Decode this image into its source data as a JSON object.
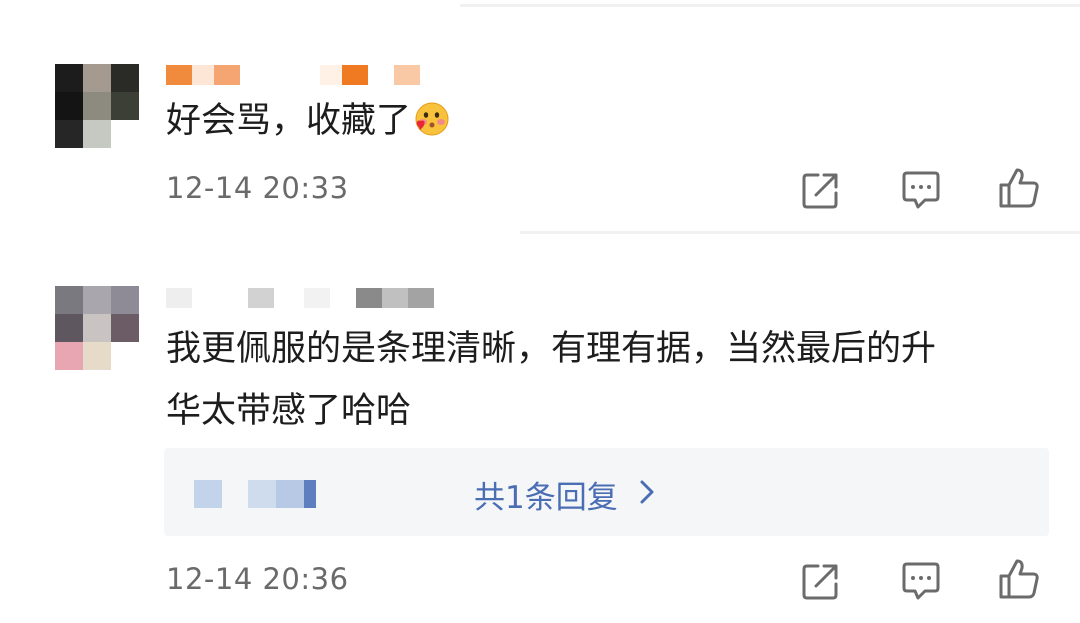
{
  "colors": {
    "link": "#4a6db3",
    "time": "#6a6a6a",
    "text": "#1d1d1d",
    "icon": "#6b6b6b",
    "reply_bg": "#f5f6f8"
  },
  "comments": [
    {
      "text": "好会骂，收藏了",
      "emoji": "smiling-face-with-heart-kiss-icon",
      "time": "12-14 20:33",
      "actions": [
        "share-icon",
        "comment-icon",
        "like-icon"
      ]
    },
    {
      "text_line1": "我更佩服的是条理清晰，有理有据，当然最后的升",
      "text_line2": "华太带感了哈哈",
      "replies_label": "共1条回复",
      "time": "12-14 20:36",
      "actions": [
        "share-icon",
        "comment-icon",
        "like-icon"
      ]
    }
  ]
}
